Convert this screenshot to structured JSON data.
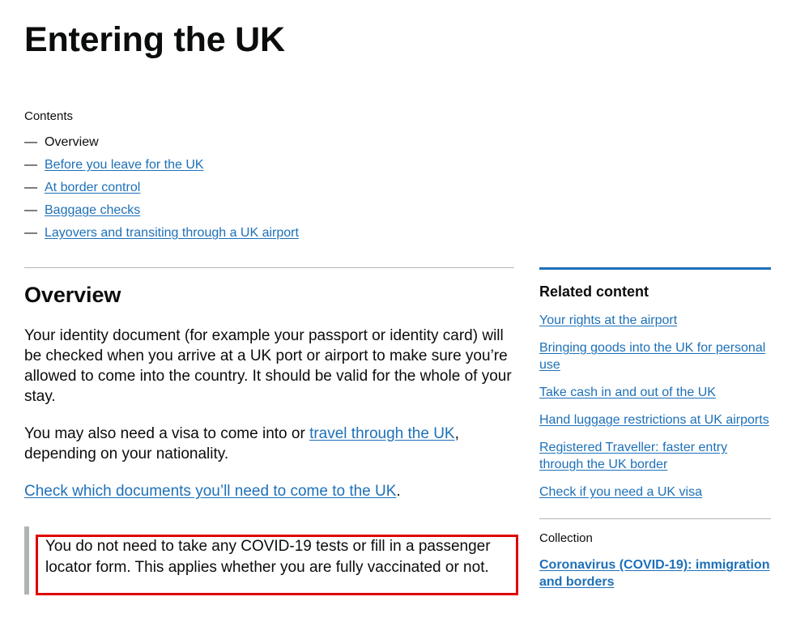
{
  "page": {
    "title": "Entering the UK"
  },
  "contents": {
    "heading": "Contents",
    "dash": "—",
    "items": [
      {
        "label": "Overview",
        "is_link": false
      },
      {
        "label": "Before you leave for the UK",
        "is_link": true
      },
      {
        "label": "At border control",
        "is_link": true
      },
      {
        "label": "Baggage checks",
        "is_link": true
      },
      {
        "label": "Layovers and transiting through a UK airport",
        "is_link": true
      }
    ]
  },
  "main": {
    "section_heading": "Overview",
    "paragraph_1": "Your identity document (for example your passport or identity card) will be checked when you arrive at a UK port or airport to make sure you’re allowed to come into the country. It should be valid for the whole of your stay.",
    "paragraph_2_before": "You may also need a visa to come into or ",
    "paragraph_2_link": "travel through the UK",
    "paragraph_2_after": ", depending on your nationality.",
    "paragraph_3_link": "Check which documents you’ll need to come to the UK",
    "paragraph_3_after": ".",
    "callout_text": "You do not need to take any COVID-19 tests or fill in a passenger locator form. This applies whether you are fully vaccinated or not."
  },
  "sidebar": {
    "related_heading": "Related content",
    "related_links": [
      "Your rights at the airport",
      "Bringing goods into the UK for personal use",
      "Take cash in and out of the UK",
      "Hand luggage restrictions at UK airports",
      "Registered Traveller: faster entry through the UK border",
      "Check if you need a UK visa"
    ],
    "collection_label": "Collection",
    "collection_link": "Coronavirus (COVID-19): immigration and borders"
  },
  "colors": {
    "link_blue": "#1d70b8",
    "text_black": "#0b0c0c",
    "divider_grey": "#b1b4b6",
    "annotation_red": "#e00000"
  }
}
